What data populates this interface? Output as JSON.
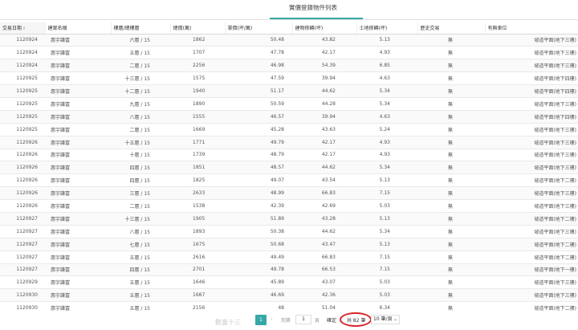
{
  "tab": {
    "title": "實價登錄物件列表"
  },
  "columns": [
    {
      "label": "交易日期",
      "sorted": true
    },
    {
      "label": "建案名稱"
    },
    {
      "label": "樓層/總樓層"
    },
    {
      "label": "總價(萬)"
    },
    {
      "label": "單價(坪/萬)"
    },
    {
      "label": "建物移轉(坪)"
    },
    {
      "label": "土地移轉(坪)"
    },
    {
      "label": "歷史交易"
    },
    {
      "label": "有無車位"
    }
  ],
  "rows": [
    [
      "1120924",
      "惠宇謙富",
      "六層 / 15",
      "1862",
      "50.48",
      "43.82",
      "5.13",
      "無",
      "坡道平面(地下三樓)"
    ],
    [
      "1120924",
      "惠宇謙富",
      "五層 / 15",
      "1707",
      "47.78",
      "42.17",
      "4.93",
      "無",
      "坡道平面(地下三樓)"
    ],
    [
      "1120924",
      "惠宇謙富",
      "二層 / 15",
      "2256",
      "46.98",
      "54.39",
      "6.85",
      "無",
      "坡道平面(地下三樓)"
    ],
    [
      "1120925",
      "惠宇謙富",
      "十三層 / 15",
      "1575",
      "47.59",
      "39.94",
      "4.63",
      "無",
      "坡道平面(地下四樓)"
    ],
    [
      "1120925",
      "惠宇謙富",
      "十二層 / 15",
      "1940",
      "51.17",
      "44.62",
      "5.34",
      "無",
      "坡道平面(地下四樓)"
    ],
    [
      "1120925",
      "惠宇謙富",
      "九層 / 15",
      "1890",
      "50.59",
      "44.28",
      "5.34",
      "無",
      "坡道平面(地下三樓)"
    ],
    [
      "1120925",
      "惠宇謙富",
      "八層 / 15",
      "1555",
      "46.57",
      "39.94",
      "4.63",
      "無",
      "坡道平面(地下四樓)"
    ],
    [
      "1120925",
      "惠宇謙富",
      "二層 / 15",
      "1669",
      "45.28",
      "43.63",
      "5.24",
      "無",
      "坡道平面(地下三樓)"
    ],
    [
      "1120926",
      "惠宇謙富",
      "十五層 / 15",
      "1771",
      "49.79",
      "42.17",
      "4.93",
      "無",
      "坡道平面(地下三樓)"
    ],
    [
      "1120926",
      "惠宇謙富",
      "十層 / 15",
      "1739",
      "48.79",
      "42.17",
      "4.93",
      "無",
      "坡道平面(地下三樓)"
    ],
    [
      "1120926",
      "惠宇謙富",
      "四層 / 15",
      "1851",
      "48.57",
      "44.62",
      "5.34",
      "無",
      "坡道平面(地下三樓)"
    ],
    [
      "1120926",
      "惠宇謙富",
      "四層 / 15",
      "1825",
      "49.07",
      "43.54",
      "5.13",
      "無",
      "坡道平面(地下二樓)"
    ],
    [
      "1120926",
      "惠宇謙富",
      "三層 / 15",
      "2633",
      "48.99",
      "66.83",
      "7.15",
      "無",
      "坡道平面(地下三樓)"
    ],
    [
      "1120926",
      "惠宇謙富",
      "二層 / 15",
      "1538",
      "42.39",
      "42.69",
      "5.03",
      "無",
      "坡道平面(地下三樓)"
    ],
    [
      "1120927",
      "惠宇謙富",
      "十三層 / 15",
      "1905",
      "51.89",
      "43.28",
      "5.13",
      "無",
      "坡道平面(地下二樓)"
    ],
    [
      "1120927",
      "惠宇謙富",
      "八層 / 15",
      "1893",
      "50.38",
      "44.62",
      "5.34",
      "無",
      "坡道平面(地下三樓)"
    ],
    [
      "1120927",
      "惠宇謙富",
      "七層 / 15",
      "1675",
      "50.68",
      "43.47",
      "5.13",
      "無",
      "坡道平面(地下二樓)"
    ],
    [
      "1120927",
      "惠宇謙富",
      "五層 / 15",
      "2616",
      "49.49",
      "66.83",
      "7.15",
      "無",
      "坡道平面(地下二樓)"
    ],
    [
      "1120927",
      "惠宇謙富",
      "四層 / 15",
      "2701",
      "49.78",
      "66.53",
      "7.15",
      "無",
      "坡道平面(地下一樓)"
    ],
    [
      "1120929",
      "惠宇謙富",
      "五層 / 15",
      "1646",
      "45.89",
      "43.07",
      "5.03",
      "無",
      "坡道平面(地下三樓)"
    ],
    [
      "1120930",
      "惠宇謙富",
      "五層 / 15",
      "1687",
      "46.69",
      "42.36",
      "5.03",
      "無",
      "坡道平面(地下三樓)"
    ],
    [
      "1120930",
      "惠宇謙富",
      "五層 / 15",
      "2156",
      "48",
      "51.04",
      "6.34",
      "無",
      "坡道平面(地下二樓)"
    ]
  ],
  "pagination": {
    "faded_text": "數富十三",
    "current_page": "1",
    "next_arrow": "›",
    "goto_label": "到第",
    "goto_value": "1",
    "goto_suffix": "頁",
    "confirm_label": "確定",
    "total_label": "共 82 筆",
    "page_size": "10 筆/頁"
  },
  "colors": {
    "accent": "#35a7a7",
    "highlight_ring": "#d9242b"
  },
  "icons": {
    "sort": "sort-icon",
    "chevron": "chevron-down-icon"
  }
}
